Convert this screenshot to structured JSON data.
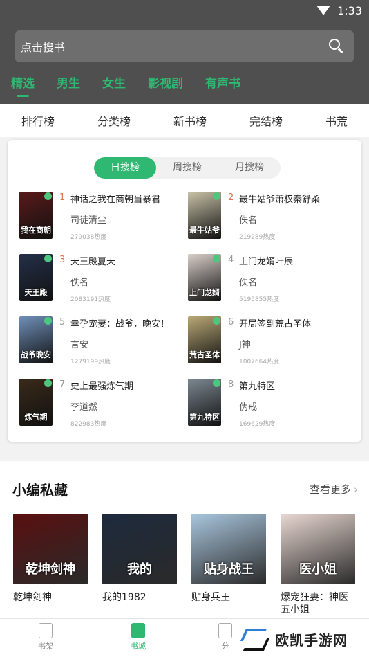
{
  "status": {
    "time": "1:33",
    "wifi_icon": "wifi-icon"
  },
  "search": {
    "placeholder": "点击搜书",
    "icon": "search-icon"
  },
  "top_tabs": [
    "精选",
    "男生",
    "女生",
    "影视剧",
    "有声书"
  ],
  "categories": [
    "排行榜",
    "分类榜",
    "新书榜",
    "完结榜",
    "书荒"
  ],
  "ranking": {
    "periods": [
      "日搜榜",
      "周搜榜",
      "月搜榜"
    ],
    "books": [
      {
        "rank": "1",
        "name": "神话之我在商朝当暴君",
        "author": "司徒清尘",
        "heat": "279038热度",
        "cover_text": "我在商朝",
        "color": "#5a1a1a"
      },
      {
        "rank": "2",
        "name": "最牛姑爷萧权秦舒柔",
        "author": "佚名",
        "heat": "219289热度",
        "cover_text": "最牛姑爷",
        "color": "#c9c2a8"
      },
      {
        "rank": "3",
        "name": "天王殿夏天",
        "author": "佚名",
        "heat": "2083191热度",
        "cover_text": "天王殿",
        "color": "#243049"
      },
      {
        "rank": "4",
        "name": "上门龙婿叶辰",
        "author": "佚名",
        "heat": "5195855热度",
        "cover_text": "上门龙婿",
        "color": "#d9cfc9"
      },
      {
        "rank": "5",
        "name": "幸孕宠妻：战爷，晚安！",
        "author": "言安",
        "heat": "1279199热度",
        "cover_text": "战爷晚安",
        "color": "#6f8fb8"
      },
      {
        "rank": "6",
        "name": "开局签到荒古圣体",
        "author": "J神",
        "heat": "1007664热度",
        "cover_text": "荒古圣体",
        "color": "#b9a876"
      },
      {
        "rank": "7",
        "name": "史上最强炼气期",
        "author": "李道然",
        "heat": "822983热度",
        "cover_text": "炼气期",
        "color": "#3a2a1a"
      },
      {
        "rank": "8",
        "name": "第九特区",
        "author": "伪戒",
        "heat": "169629热度",
        "cover_text": "第九特区",
        "color": "#7c8891"
      }
    ]
  },
  "section": {
    "title": "小编私藏",
    "more": "查看更多",
    "items": [
      {
        "name": "乾坤剑神",
        "cover_text": "乾坤剑神",
        "color": "#5a0f0f"
      },
      {
        "name": "我的1982",
        "cover_text": "我的",
        "color": "#1d2a3d"
      },
      {
        "name": "贴身兵王",
        "cover_text": "贴身战王",
        "color": "#a9c6de"
      },
      {
        "name": "爆宠狂妻：神医五小姐",
        "cover_text": "医小姐",
        "color": "#e9d8d2"
      }
    ]
  },
  "nav": [
    "书架",
    "书城",
    "分"
  ],
  "watermark": "欧凯手游网",
  "accent": "#2eb872"
}
